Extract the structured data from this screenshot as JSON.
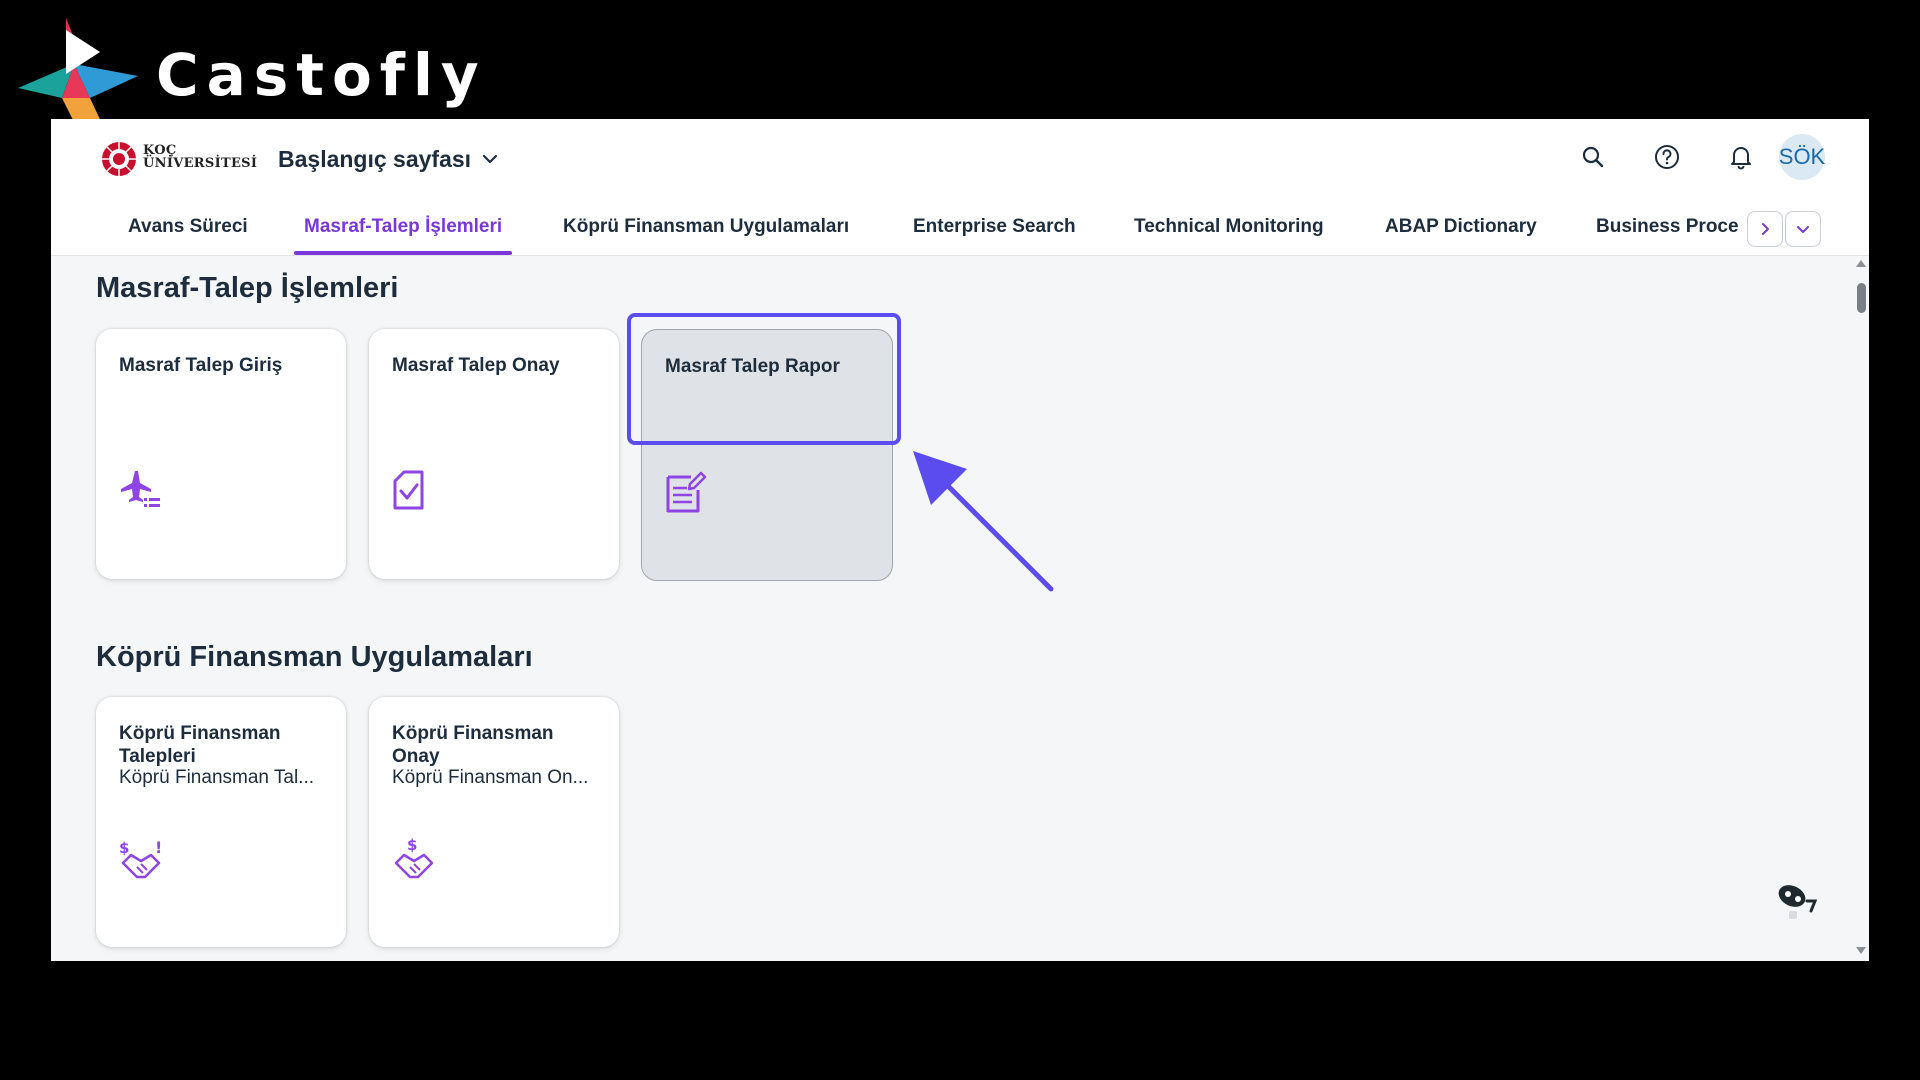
{
  "brand": {
    "name": "Castofly"
  },
  "shell": {
    "logo_line1": "KOÇ",
    "logo_line2": "ÜNİVERSİTESİ",
    "home_title": "Başlangıç sayfası",
    "avatar_initials": "SÖK"
  },
  "tabs": [
    {
      "label": "Avans Süreci",
      "active": false
    },
    {
      "label": "Masraf-Talep İşlemleri",
      "active": true
    },
    {
      "label": "Köprü Finansman Uygulamaları",
      "active": false
    },
    {
      "label": "Enterprise Search",
      "active": false
    },
    {
      "label": "Technical Monitoring",
      "active": false
    },
    {
      "label": "ABAP Dictionary",
      "active": false
    },
    {
      "label": "Business Proces",
      "active": false
    }
  ],
  "sections": [
    {
      "title": "Masraf-Talep İşlemleri",
      "tiles": [
        {
          "title": "Masraf Talep Giriş",
          "subtitle": "",
          "icon": "airplane-list-icon"
        },
        {
          "title": "Masraf Talep Onay",
          "subtitle": "",
          "icon": "document-check-icon"
        },
        {
          "title": "Masraf Talep Rapor",
          "subtitle": "",
          "icon": "document-edit-icon"
        }
      ]
    },
    {
      "title": "Köprü Finansman Uygulamaları",
      "tiles": [
        {
          "title": "Köprü Finansman Talepleri",
          "subtitle": "Köprü Finansman Tal...",
          "icon": "handshake-money-alert-icon"
        },
        {
          "title": "Köprü Finansman Onay",
          "subtitle": "Köprü Finansman On...",
          "icon": "handshake-money-icon"
        }
      ]
    }
  ],
  "colors": {
    "accent": "#7a37d9",
    "annotation": "#5b4cf0",
    "text": "#1d2d3e",
    "page_bg": "#f5f6f7"
  }
}
